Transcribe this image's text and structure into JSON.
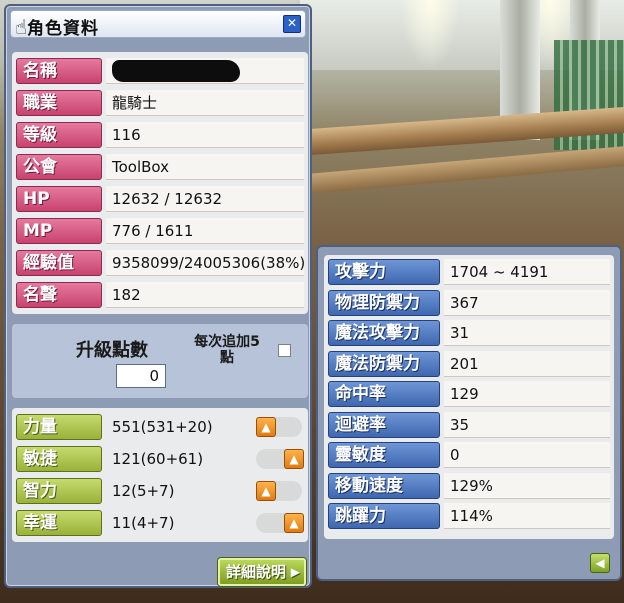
{
  "window": {
    "title": "角色資料",
    "close_icon": "close-icon"
  },
  "profile": [
    {
      "label": "名稱",
      "value": ""
    },
    {
      "label": "職業",
      "value": "龍騎士"
    },
    {
      "label": "等級",
      "value": "116"
    },
    {
      "label": "公會",
      "value": "ToolBox"
    },
    {
      "label": "HP",
      "value": "12632 / 12632"
    },
    {
      "label": "MP",
      "value": "776 / 1611"
    },
    {
      "label": "經驗值",
      "value": "9358099/24005306(38%)"
    },
    {
      "label": "名聲",
      "value": "182"
    }
  ],
  "level_up": {
    "label": "升級點數",
    "points": "0",
    "add5_label": "每次追加5\n點",
    "add5_checked": false
  },
  "stats": [
    {
      "label": "力量",
      "value": "551(531+20)"
    },
    {
      "label": "敏捷",
      "value": "121(60+61)"
    },
    {
      "label": "智力",
      "value": "12(5+7)"
    },
    {
      "label": "幸運",
      "value": "11(4+7)"
    }
  ],
  "detail_button": {
    "label": "詳細說明"
  },
  "details": [
    {
      "label": "攻擊力",
      "value": "1704 ~ 4191"
    },
    {
      "label": "物理防禦力",
      "value": "367"
    },
    {
      "label": "魔法攻擊力",
      "value": "31"
    },
    {
      "label": "魔法防禦力",
      "value": "201"
    },
    {
      "label": "命中率",
      "value": "129"
    },
    {
      "label": "迴避率",
      "value": "35"
    },
    {
      "label": "靈敏度",
      "value": "0"
    },
    {
      "label": "移動速度",
      "value": "129%"
    },
    {
      "label": "跳躍力",
      "value": "114%"
    }
  ],
  "colors": {
    "panel": "#8d9cb4",
    "label_pink": "#c8426f",
    "label_green": "#99b23a",
    "label_blue": "#3e67b0",
    "up_button": "#e07b0f"
  }
}
